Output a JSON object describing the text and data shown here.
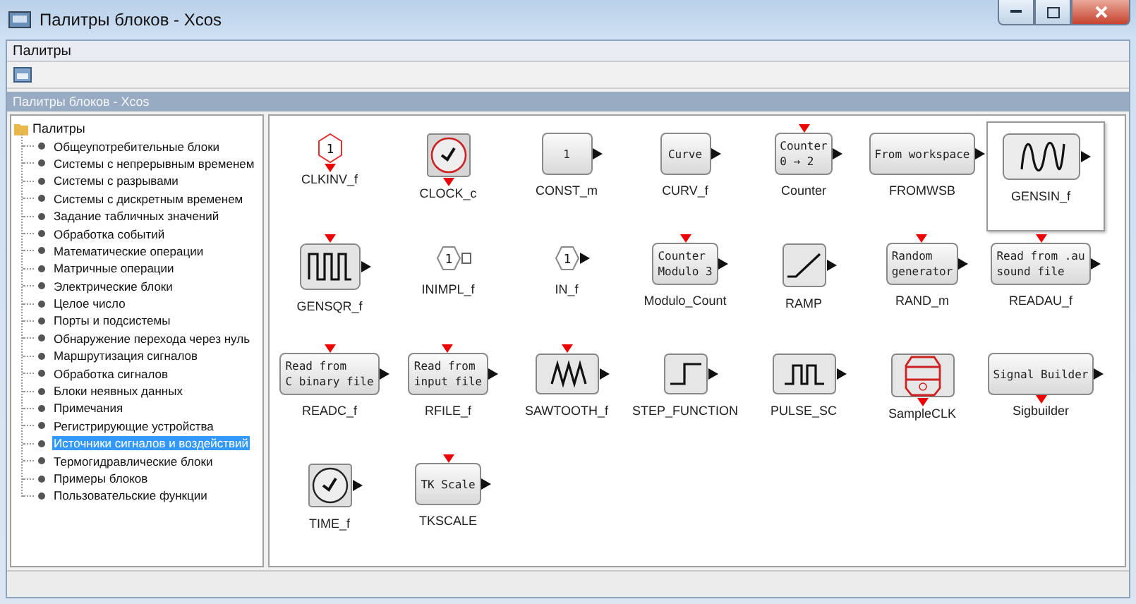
{
  "window": {
    "title": "Палитры блоков - Xcos"
  },
  "menu": [
    "Палитры"
  ],
  "panel": {
    "title": "Палитры блоков - Xcos"
  },
  "tree": {
    "label": "Палитры",
    "children": [
      {
        "label": "Общеупотребительные блоки",
        "selected": false
      },
      {
        "label": "Системы с непрерывным временем",
        "selected": false
      },
      {
        "label": "Системы с разрывами",
        "selected": false
      },
      {
        "label": "Системы с дискретным временем",
        "selected": false
      },
      {
        "label": "Задание табличных значений",
        "selected": false
      },
      {
        "label": "Обработка событий",
        "selected": false
      },
      {
        "label": "Математические операции",
        "selected": false
      },
      {
        "label": "Матричные операции",
        "selected": false
      },
      {
        "label": "Электрические блоки",
        "selected": false
      },
      {
        "label": "Целое число",
        "selected": false
      },
      {
        "label": "Порты и подсистемы",
        "selected": false
      },
      {
        "label": "Обнаружение перехода через нуль",
        "selected": false
      },
      {
        "label": "Маршрутизация сигналов",
        "selected": false
      },
      {
        "label": "Обработка сигналов",
        "selected": false
      },
      {
        "label": "Блоки неявных данных",
        "selected": false
      },
      {
        "label": "Примечания",
        "selected": false
      },
      {
        "label": "Регистрирующие устройства",
        "selected": false
      },
      {
        "label": "Источники сигналов и воздействий",
        "selected": true
      },
      {
        "label": "Термогидравлические блоки",
        "selected": false
      },
      {
        "label": "Примеры блоков",
        "selected": false
      },
      {
        "label": "Пользовательские функции",
        "selected": false
      }
    ]
  },
  "blocks": [
    {
      "name": "CLKINV_f",
      "kind": "event-hex",
      "text": [
        "1"
      ],
      "event_in": false,
      "event_out": true,
      "output": false,
      "selected": false
    },
    {
      "name": "CLOCK_c",
      "kind": "clock",
      "event_in": false,
      "event_out": true,
      "output": false,
      "selected": false
    },
    {
      "name": "CONST_m",
      "kind": "box",
      "text": [
        "1"
      ],
      "event_in": false,
      "event_out": false,
      "output": true,
      "selected": false
    },
    {
      "name": "CURV_f",
      "kind": "box",
      "text": [
        "Curve"
      ],
      "event_in": false,
      "event_out": false,
      "output": true,
      "selected": false
    },
    {
      "name": "Counter",
      "kind": "box",
      "text": [
        "Counter",
        "0 → 2"
      ],
      "event_in": true,
      "event_out": false,
      "output": true,
      "selected": false
    },
    {
      "name": "FROMWSB",
      "kind": "box",
      "text": [
        "From workspace"
      ],
      "event_in": false,
      "event_out": false,
      "output": true,
      "selected": false
    },
    {
      "name": "GENSIN_f",
      "kind": "sine",
      "event_in": false,
      "event_out": false,
      "output": true,
      "selected": true
    },
    {
      "name": "GENSQR_f",
      "kind": "square",
      "event_in": true,
      "event_out": false,
      "output": true,
      "selected": false
    },
    {
      "name": "INIMPL_f",
      "kind": "hex-implicit",
      "text": [
        "1"
      ],
      "event_in": false,
      "event_out": false,
      "output": true,
      "selected": false
    },
    {
      "name": "IN_f",
      "kind": "hex",
      "text": [
        "1"
      ],
      "event_in": false,
      "event_out": false,
      "output": true,
      "selected": false
    },
    {
      "name": "Modulo_Count",
      "kind": "box",
      "text": [
        "Counter",
        "Modulo 3"
      ],
      "event_in": true,
      "event_out": false,
      "output": true,
      "selected": false
    },
    {
      "name": "RAMP",
      "kind": "ramp",
      "event_in": false,
      "event_out": false,
      "output": true,
      "selected": false
    },
    {
      "name": "RAND_m",
      "kind": "box",
      "text": [
        "Random",
        "generator"
      ],
      "event_in": true,
      "event_out": false,
      "output": true,
      "selected": false
    },
    {
      "name": "READAU_f",
      "kind": "box",
      "text": [
        "Read from .au",
        "sound file"
      ],
      "event_in": true,
      "event_out": false,
      "output": true,
      "selected": false
    },
    {
      "name": "READC_f",
      "kind": "box",
      "text": [
        "Read from",
        "C binary file"
      ],
      "event_in": true,
      "event_out": false,
      "output": true,
      "selected": false
    },
    {
      "name": "RFILE_f",
      "kind": "box",
      "text": [
        "Read from",
        "input file"
      ],
      "event_in": true,
      "event_out": false,
      "output": true,
      "selected": false
    },
    {
      "name": "SAWTOOTH_f",
      "kind": "sawtooth",
      "event_in": true,
      "event_out": false,
      "output": true,
      "selected": false
    },
    {
      "name": "STEP_FUNCTION",
      "kind": "step",
      "event_in": false,
      "event_out": false,
      "output": true,
      "selected": false
    },
    {
      "name": "PULSE_SC",
      "kind": "pulse",
      "event_in": false,
      "event_out": false,
      "output": true,
      "selected": false
    },
    {
      "name": "SampleCLK",
      "kind": "sampleclk",
      "event_in": false,
      "event_out": true,
      "output": false,
      "selected": false
    },
    {
      "name": "Sigbuilder",
      "kind": "box",
      "text": [
        "Signal Builder"
      ],
      "event_in": false,
      "event_out": true,
      "output": true,
      "selected": false
    },
    {
      "name": "TIME_f",
      "kind": "timer",
      "event_in": false,
      "event_out": false,
      "output": true,
      "selected": false
    },
    {
      "name": "TKSCALE",
      "kind": "box",
      "text": [
        "TK Scale"
      ],
      "event_in": true,
      "event_out": false,
      "output": true,
      "selected": false
    }
  ]
}
